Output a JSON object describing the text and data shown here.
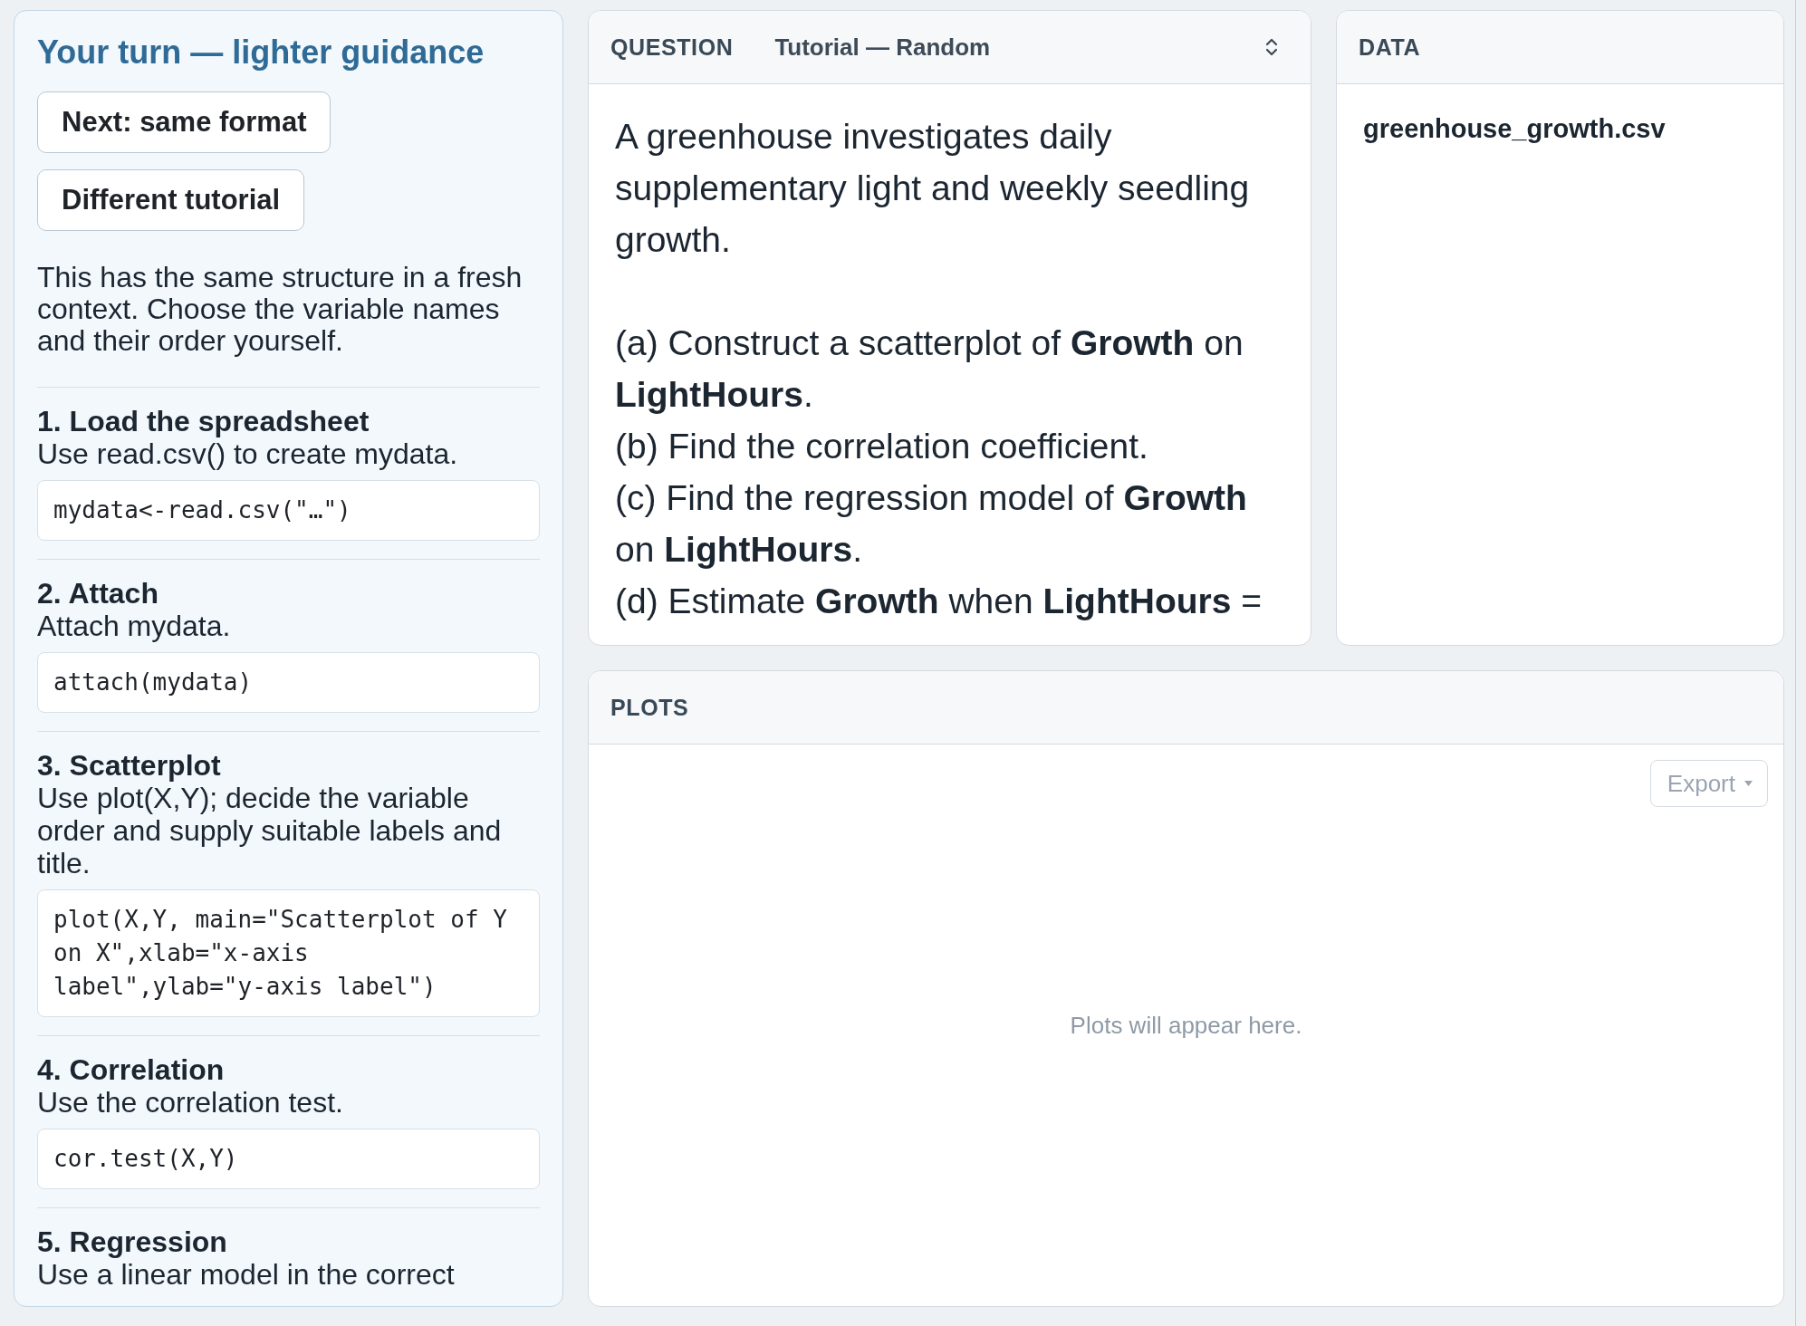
{
  "guide": {
    "title": "Your turn — lighter guidance",
    "buttons": [
      {
        "label": "Next: same format"
      },
      {
        "label": "Different tutorial"
      }
    ],
    "intro": "This has the same structure in a fresh context. Choose the variable names and their order yourself.",
    "steps": [
      {
        "heading": "1. Load the spreadsheet",
        "instruction": "Use read.csv() to create mydata.",
        "code": "mydata<-read.csv(\"…\")"
      },
      {
        "heading": "2. Attach",
        "instruction": "Attach mydata.",
        "code": "attach(mydata)"
      },
      {
        "heading": "3. Scatterplot",
        "instruction": "Use plot(X,Y); decide the variable order and supply suitable labels and title.",
        "code": "plot(X,Y, main=\"Scatterplot of Y on X\",xlab=\"x-axis label\",ylab=\"y-axis label\")"
      },
      {
        "heading": "4. Correlation",
        "instruction": "Use the correlation test.",
        "code": "cor.test(X,Y)"
      },
      {
        "heading": "5. Regression",
        "instruction": "Use a linear model in the correct"
      }
    ]
  },
  "question": {
    "header": "QUESTION",
    "tutorial_select": {
      "value": "Tutorial — Random"
    },
    "intro": "A greenhouse investigates daily supplementary light and weekly seedling growth.",
    "parts": [
      "(a) Construct a scatterplot of **Growth** on **LightHours**.",
      "(b) Find the correlation coefficient.",
      "(c) Find the regression model of **Growth** on **LightHours**.",
      "(d) Estimate **Growth** when **LightHours** ="
    ]
  },
  "data": {
    "header": "DATA",
    "files": [
      "greenhouse_growth.csv"
    ]
  },
  "plots": {
    "header": "PLOTS",
    "export_button": {
      "label": "Export",
      "disabled": true
    },
    "placeholder": "Plots will appear here."
  }
}
